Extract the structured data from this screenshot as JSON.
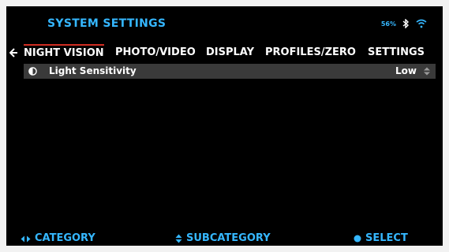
{
  "header": {
    "title": "SYSTEM SETTINGS",
    "battery": "56%",
    "icons": [
      "bluetooth-icon",
      "wifi-icon"
    ]
  },
  "nav": {
    "back_icon": "back-arrow-icon",
    "tabs": [
      {
        "label": "NIGHT VISION",
        "active": true
      },
      {
        "label": "PHOTO/VIDEO",
        "active": false
      },
      {
        "label": "DISPLAY",
        "active": false
      },
      {
        "label": "PROFILES/ZERO",
        "active": false
      },
      {
        "label": "SETTINGS",
        "active": false
      }
    ]
  },
  "settings": {
    "rows": [
      {
        "icon": "half-circle-icon",
        "label": "Light Sensitivity",
        "value": "Low",
        "control_icon": "up-down-icon"
      }
    ]
  },
  "footer": {
    "hints": [
      {
        "icon": "left-right-icon",
        "label": "CATEGORY"
      },
      {
        "icon": "up-down-icon",
        "label": "SUBCATEGORY"
      },
      {
        "icon": "dot-icon",
        "label": "SELECT"
      }
    ]
  },
  "colors": {
    "accent": "#35b7ff",
    "active_tab_marker": "#d12d22",
    "selected_row": "#3a3a3a",
    "background": "#000000"
  }
}
